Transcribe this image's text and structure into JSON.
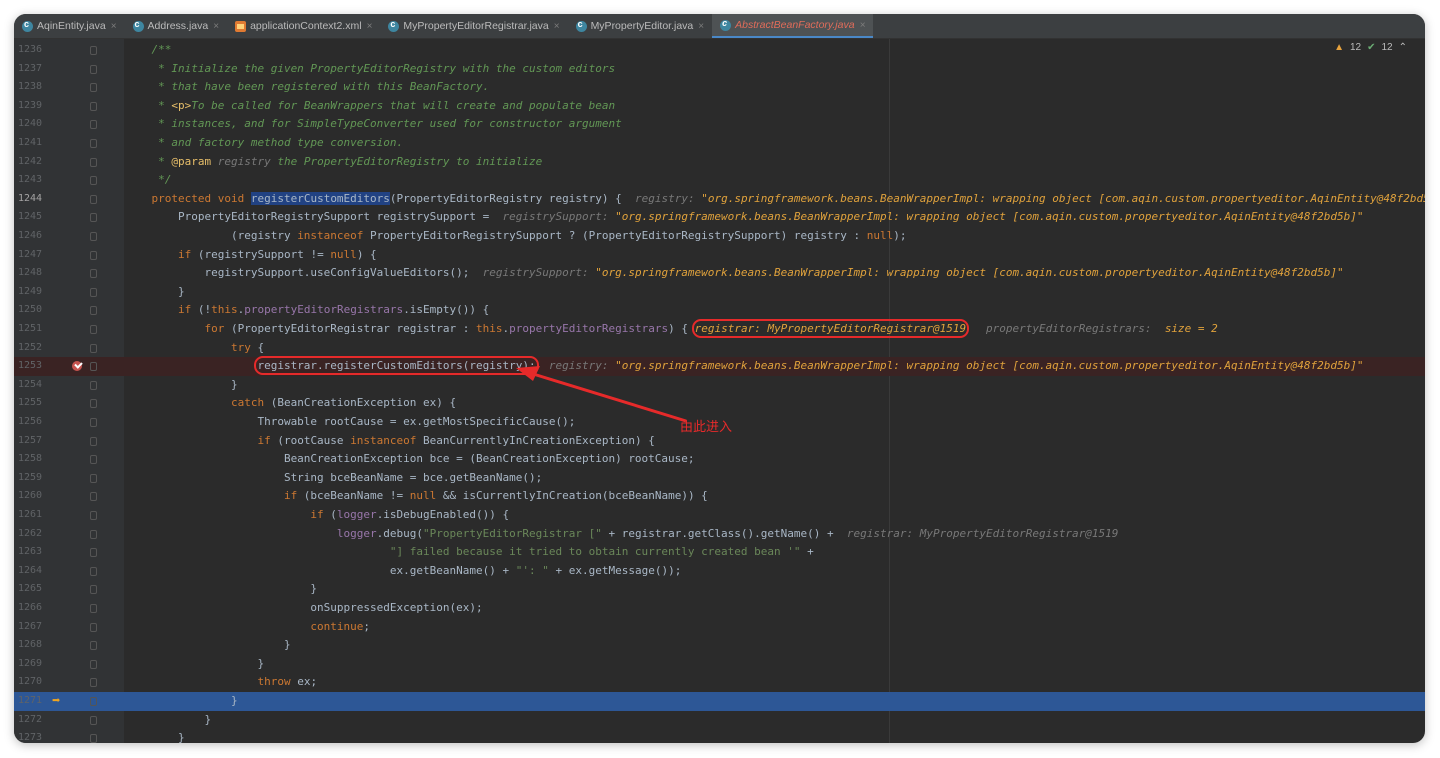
{
  "tabs": [
    {
      "label": "AqinEntity.java",
      "icon": "class-icon"
    },
    {
      "label": "Address.java",
      "icon": "class-icon"
    },
    {
      "label": "applicationContext2.xml",
      "icon": "xml-icon"
    },
    {
      "label": "MyPropertyEditorRegistrar.java",
      "icon": "class-icon"
    },
    {
      "label": "MyPropertyEditor.java",
      "icon": "class-icon"
    },
    {
      "label": "AbstractBeanFactory.java",
      "icon": "class-icon",
      "active": true
    }
  ],
  "inspections": {
    "warnings": "12",
    "ok": "12"
  },
  "annotation": "由此进入",
  "lines": [
    {
      "n": "1236",
      "segs": [
        [
          "cm",
          "    /**"
        ]
      ]
    },
    {
      "n": "1237",
      "segs": [
        [
          "cm",
          "     * Initialize the given PropertyEditorRegistry with the custom editors"
        ]
      ]
    },
    {
      "n": "1238",
      "segs": [
        [
          "cm",
          "     * that have been registered with this BeanFactory."
        ]
      ]
    },
    {
      "n": "1239",
      "segs": [
        [
          "cm",
          "     * "
        ],
        [
          "tag",
          "<p>"
        ],
        [
          "cm",
          "To be called for BeanWrappers that will create and populate bean"
        ]
      ]
    },
    {
      "n": "1240",
      "segs": [
        [
          "cm",
          "     * instances, and for SimpleTypeConverter used for constructor argument"
        ]
      ]
    },
    {
      "n": "1241",
      "segs": [
        [
          "cm",
          "     * and factory method type conversion."
        ]
      ]
    },
    {
      "n": "1242",
      "segs": [
        [
          "cm",
          "     * "
        ],
        [
          "tag",
          "@param"
        ],
        [
          "hint",
          " registry"
        ],
        [
          "cm",
          " the PropertyEditorRegistry to initialize"
        ]
      ]
    },
    {
      "n": "1243",
      "segs": [
        [
          "cm",
          "     */"
        ]
      ]
    },
    {
      "n": "1244",
      "cur": true,
      "segs": [
        [
          "kw",
          "    protected void "
        ],
        [
          "sel",
          "registerCustomEditors"
        ],
        [
          "",
          "(PropertyEditorRegistry registry) {  "
        ],
        [
          "hint",
          "registry: "
        ],
        [
          "hv",
          "\"org.springframework.beans.BeanWrapperImpl: wrapping object [com.aqin.custom.propertyeditor.AqinEntity@48f2bd5b]\""
        ]
      ]
    },
    {
      "n": "1245",
      "segs": [
        [
          "",
          "        PropertyEditorRegistrySupport registrySupport =  "
        ],
        [
          "hint",
          "registrySupport: "
        ],
        [
          "hv",
          "\"org.springframework.beans.BeanWrapperImpl: wrapping object [com.aqin.custom.propertyeditor.AqinEntity@48f2bd5b]\""
        ]
      ]
    },
    {
      "n": "1246",
      "segs": [
        [
          "",
          "                (registry "
        ],
        [
          "kw",
          "instanceof"
        ],
        [
          "",
          " PropertyEditorRegistrySupport ? (PropertyEditorRegistrySupport) registry : "
        ],
        [
          "kw",
          "null"
        ],
        [
          "",
          ");"
        ]
      ]
    },
    {
      "n": "1247",
      "segs": [
        [
          "kw",
          "        if"
        ],
        [
          "",
          " (registrySupport != "
        ],
        [
          "kw",
          "null"
        ],
        [
          "",
          ") {"
        ]
      ]
    },
    {
      "n": "1248",
      "segs": [
        [
          "",
          "            registrySupport.useConfigValueEditors();  "
        ],
        [
          "hint",
          "registrySupport: "
        ],
        [
          "hv",
          "\"org.springframework.beans.BeanWrapperImpl: wrapping object [com.aqin.custom.propertyeditor.AqinEntity@48f2bd5b]\""
        ]
      ]
    },
    {
      "n": "1249",
      "segs": [
        [
          "",
          "        }"
        ]
      ]
    },
    {
      "n": "1250",
      "segs": [
        [
          "kw",
          "        if"
        ],
        [
          "",
          " (!"
        ],
        [
          "kw",
          "this"
        ],
        [
          "",
          "."
        ],
        [
          "fd",
          "propertyEditorRegistrars"
        ],
        [
          "",
          ".isEmpty()) {"
        ]
      ]
    },
    {
      "n": "1251",
      "segs": [
        [
          "kw",
          "            for"
        ],
        [
          "",
          " (PropertyEditorRegistrar registrar : "
        ],
        [
          "kw",
          "this"
        ],
        [
          "",
          "."
        ],
        [
          "fd",
          "propertyEditorRegistrars"
        ],
        [
          "",
          ") { "
        ],
        [
          "boxA",
          ""
        ],
        [
          "hint",
          "   propertyEditorRegistrars:  "
        ],
        [
          "hv",
          "size = 2"
        ]
      ]
    },
    {
      "n": "1252",
      "segs": [
        [
          "kw",
          "                try"
        ],
        [
          "",
          " {"
        ]
      ]
    },
    {
      "n": "1253",
      "bp": true,
      "segs": [
        [
          "",
          "                    "
        ],
        [
          "boxB",
          "registrar.registerCustomEditors(registry);"
        ],
        [
          "hint",
          "  registry: "
        ],
        [
          "hv",
          "\"org.springframework.beans.BeanWrapperImpl: wrapping object [com.aqin.custom.propertyeditor.AqinEntity@48f2bd5b]\""
        ]
      ]
    },
    {
      "n": "1254",
      "segs": [
        [
          "",
          "                }"
        ]
      ]
    },
    {
      "n": "1255",
      "segs": [
        [
          "kw",
          "                catch"
        ],
        [
          "",
          " (BeanCreationException ex) {"
        ]
      ]
    },
    {
      "n": "1256",
      "segs": [
        [
          "",
          "                    Throwable rootCause = ex.getMostSpecificCause();"
        ]
      ]
    },
    {
      "n": "1257",
      "segs": [
        [
          "kw",
          "                    if"
        ],
        [
          "",
          " (rootCause "
        ],
        [
          "kw",
          "instanceof"
        ],
        [
          "",
          " BeanCurrentlyInCreationException) {"
        ]
      ]
    },
    {
      "n": "1258",
      "segs": [
        [
          "",
          "                        BeanCreationException bce = (BeanCreationException) rootCause;"
        ]
      ]
    },
    {
      "n": "1259",
      "segs": [
        [
          "",
          "                        String bceBeanName = bce.getBeanName();"
        ]
      ]
    },
    {
      "n": "1260",
      "segs": [
        [
          "kw",
          "                        if"
        ],
        [
          "",
          " (bceBeanName != "
        ],
        [
          "kw",
          "null"
        ],
        [
          "",
          " && isCurrentlyInCreation(bceBeanName)) {"
        ]
      ]
    },
    {
      "n": "1261",
      "segs": [
        [
          "kw",
          "                            if"
        ],
        [
          "",
          " ("
        ],
        [
          "fd",
          "logger"
        ],
        [
          "",
          ".isDebugEnabled()) {"
        ]
      ]
    },
    {
      "n": "1262",
      "segs": [
        [
          "fd",
          "                                logger"
        ],
        [
          "",
          ".debug("
        ],
        [
          "st",
          "\"PropertyEditorRegistrar [\""
        ],
        [
          "",
          " + registrar.getClass().getName() +  "
        ],
        [
          "hint",
          "registrar: MyPropertyEditorRegistrar@1519"
        ]
      ]
    },
    {
      "n": "1263",
      "segs": [
        [
          "st",
          "                                        \"] failed because it tried to obtain currently created bean '\""
        ],
        [
          "",
          " +"
        ]
      ]
    },
    {
      "n": "1264",
      "segs": [
        [
          "",
          "                                        ex.getBeanName() + "
        ],
        [
          "st",
          "\"': \""
        ],
        [
          "",
          " + ex.getMessage());"
        ]
      ]
    },
    {
      "n": "1265",
      "segs": [
        [
          "",
          "                            }"
        ]
      ]
    },
    {
      "n": "1266",
      "segs": [
        [
          "",
          "                            onSuppressedException(ex);"
        ]
      ]
    },
    {
      "n": "1267",
      "segs": [
        [
          "kw",
          "                            continue"
        ],
        [
          "",
          ";"
        ]
      ]
    },
    {
      "n": "1268",
      "segs": [
        [
          "",
          "                        }"
        ]
      ]
    },
    {
      "n": "1269",
      "segs": [
        [
          "",
          "                    }"
        ]
      ]
    },
    {
      "n": "1270",
      "segs": [
        [
          "kw",
          "                    throw"
        ],
        [
          "",
          " ex;"
        ]
      ]
    },
    {
      "n": "1271",
      "exec": true,
      "segs": [
        [
          "",
          "                }"
        ]
      ]
    },
    {
      "n": "1272",
      "segs": [
        [
          "",
          "            }"
        ]
      ]
    },
    {
      "n": "1273",
      "segs": [
        [
          "",
          "        }"
        ]
      ]
    }
  ],
  "boxA_text": "registrar: MyPropertyEditorRegistrar@1519"
}
